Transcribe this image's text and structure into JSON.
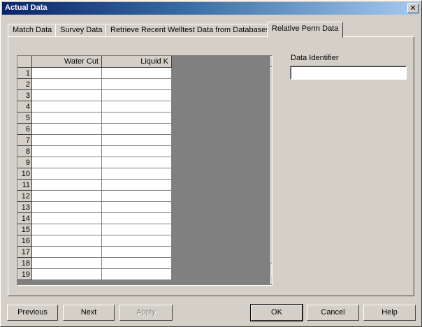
{
  "window": {
    "title": "Actual Data",
    "close_glyph": "✕"
  },
  "tabs": [
    {
      "label": "Match Data",
      "active": false
    },
    {
      "label": "Survey Data",
      "active": false
    },
    {
      "label": "Retrieve Recent Welltest Data from Databases",
      "active": false
    },
    {
      "label": "Relative Perm Data",
      "active": true
    }
  ],
  "grid": {
    "columns": [
      "Water Cut",
      "Liquid K"
    ],
    "rows": [
      "1",
      "2",
      "3",
      "4",
      "5",
      "6",
      "7",
      "8",
      "9",
      "10",
      "11",
      "12",
      "13",
      "14",
      "15",
      "16",
      "17",
      "18",
      "19"
    ]
  },
  "data_identifier": {
    "label": "Data Identifier",
    "value": ""
  },
  "buttons": {
    "previous": "Previous",
    "next": "Next",
    "apply": "Apply",
    "ok": "OK",
    "cancel": "Cancel",
    "help": "Help"
  },
  "icons": {
    "scroll_up": "arrow-up-icon",
    "scroll_down": "arrow-down-icon"
  }
}
